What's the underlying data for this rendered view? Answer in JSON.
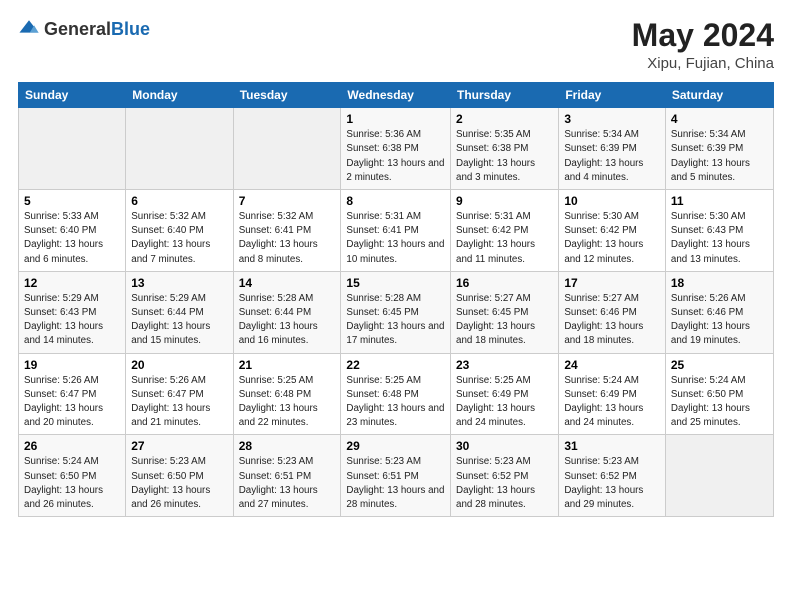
{
  "header": {
    "logo_general": "General",
    "logo_blue": "Blue",
    "title": "May 2024",
    "subtitle": "Xipu, Fujian, China"
  },
  "weekdays": [
    "Sunday",
    "Monday",
    "Tuesday",
    "Wednesday",
    "Thursday",
    "Friday",
    "Saturday"
  ],
  "weeks": [
    [
      {
        "day": "",
        "sunrise": "",
        "sunset": "",
        "daylight": "",
        "empty": true
      },
      {
        "day": "",
        "sunrise": "",
        "sunset": "",
        "daylight": "",
        "empty": true
      },
      {
        "day": "",
        "sunrise": "",
        "sunset": "",
        "daylight": "",
        "empty": true
      },
      {
        "day": "1",
        "sunrise": "Sunrise: 5:36 AM",
        "sunset": "Sunset: 6:38 PM",
        "daylight": "Daylight: 13 hours and 2 minutes.",
        "empty": false
      },
      {
        "day": "2",
        "sunrise": "Sunrise: 5:35 AM",
        "sunset": "Sunset: 6:38 PM",
        "daylight": "Daylight: 13 hours and 3 minutes.",
        "empty": false
      },
      {
        "day": "3",
        "sunrise": "Sunrise: 5:34 AM",
        "sunset": "Sunset: 6:39 PM",
        "daylight": "Daylight: 13 hours and 4 minutes.",
        "empty": false
      },
      {
        "day": "4",
        "sunrise": "Sunrise: 5:34 AM",
        "sunset": "Sunset: 6:39 PM",
        "daylight": "Daylight: 13 hours and 5 minutes.",
        "empty": false
      }
    ],
    [
      {
        "day": "5",
        "sunrise": "Sunrise: 5:33 AM",
        "sunset": "Sunset: 6:40 PM",
        "daylight": "Daylight: 13 hours and 6 minutes.",
        "empty": false
      },
      {
        "day": "6",
        "sunrise": "Sunrise: 5:32 AM",
        "sunset": "Sunset: 6:40 PM",
        "daylight": "Daylight: 13 hours and 7 minutes.",
        "empty": false
      },
      {
        "day": "7",
        "sunrise": "Sunrise: 5:32 AM",
        "sunset": "Sunset: 6:41 PM",
        "daylight": "Daylight: 13 hours and 8 minutes.",
        "empty": false
      },
      {
        "day": "8",
        "sunrise": "Sunrise: 5:31 AM",
        "sunset": "Sunset: 6:41 PM",
        "daylight": "Daylight: 13 hours and 10 minutes.",
        "empty": false
      },
      {
        "day": "9",
        "sunrise": "Sunrise: 5:31 AM",
        "sunset": "Sunset: 6:42 PM",
        "daylight": "Daylight: 13 hours and 11 minutes.",
        "empty": false
      },
      {
        "day": "10",
        "sunrise": "Sunrise: 5:30 AM",
        "sunset": "Sunset: 6:42 PM",
        "daylight": "Daylight: 13 hours and 12 minutes.",
        "empty": false
      },
      {
        "day": "11",
        "sunrise": "Sunrise: 5:30 AM",
        "sunset": "Sunset: 6:43 PM",
        "daylight": "Daylight: 13 hours and 13 minutes.",
        "empty": false
      }
    ],
    [
      {
        "day": "12",
        "sunrise": "Sunrise: 5:29 AM",
        "sunset": "Sunset: 6:43 PM",
        "daylight": "Daylight: 13 hours and 14 minutes.",
        "empty": false
      },
      {
        "day": "13",
        "sunrise": "Sunrise: 5:29 AM",
        "sunset": "Sunset: 6:44 PM",
        "daylight": "Daylight: 13 hours and 15 minutes.",
        "empty": false
      },
      {
        "day": "14",
        "sunrise": "Sunrise: 5:28 AM",
        "sunset": "Sunset: 6:44 PM",
        "daylight": "Daylight: 13 hours and 16 minutes.",
        "empty": false
      },
      {
        "day": "15",
        "sunrise": "Sunrise: 5:28 AM",
        "sunset": "Sunset: 6:45 PM",
        "daylight": "Daylight: 13 hours and 17 minutes.",
        "empty": false
      },
      {
        "day": "16",
        "sunrise": "Sunrise: 5:27 AM",
        "sunset": "Sunset: 6:45 PM",
        "daylight": "Daylight: 13 hours and 18 minutes.",
        "empty": false
      },
      {
        "day": "17",
        "sunrise": "Sunrise: 5:27 AM",
        "sunset": "Sunset: 6:46 PM",
        "daylight": "Daylight: 13 hours and 18 minutes.",
        "empty": false
      },
      {
        "day": "18",
        "sunrise": "Sunrise: 5:26 AM",
        "sunset": "Sunset: 6:46 PM",
        "daylight": "Daylight: 13 hours and 19 minutes.",
        "empty": false
      }
    ],
    [
      {
        "day": "19",
        "sunrise": "Sunrise: 5:26 AM",
        "sunset": "Sunset: 6:47 PM",
        "daylight": "Daylight: 13 hours and 20 minutes.",
        "empty": false
      },
      {
        "day": "20",
        "sunrise": "Sunrise: 5:26 AM",
        "sunset": "Sunset: 6:47 PM",
        "daylight": "Daylight: 13 hours and 21 minutes.",
        "empty": false
      },
      {
        "day": "21",
        "sunrise": "Sunrise: 5:25 AM",
        "sunset": "Sunset: 6:48 PM",
        "daylight": "Daylight: 13 hours and 22 minutes.",
        "empty": false
      },
      {
        "day": "22",
        "sunrise": "Sunrise: 5:25 AM",
        "sunset": "Sunset: 6:48 PM",
        "daylight": "Daylight: 13 hours and 23 minutes.",
        "empty": false
      },
      {
        "day": "23",
        "sunrise": "Sunrise: 5:25 AM",
        "sunset": "Sunset: 6:49 PM",
        "daylight": "Daylight: 13 hours and 24 minutes.",
        "empty": false
      },
      {
        "day": "24",
        "sunrise": "Sunrise: 5:24 AM",
        "sunset": "Sunset: 6:49 PM",
        "daylight": "Daylight: 13 hours and 24 minutes.",
        "empty": false
      },
      {
        "day": "25",
        "sunrise": "Sunrise: 5:24 AM",
        "sunset": "Sunset: 6:50 PM",
        "daylight": "Daylight: 13 hours and 25 minutes.",
        "empty": false
      }
    ],
    [
      {
        "day": "26",
        "sunrise": "Sunrise: 5:24 AM",
        "sunset": "Sunset: 6:50 PM",
        "daylight": "Daylight: 13 hours and 26 minutes.",
        "empty": false
      },
      {
        "day": "27",
        "sunrise": "Sunrise: 5:23 AM",
        "sunset": "Sunset: 6:50 PM",
        "daylight": "Daylight: 13 hours and 26 minutes.",
        "empty": false
      },
      {
        "day": "28",
        "sunrise": "Sunrise: 5:23 AM",
        "sunset": "Sunset: 6:51 PM",
        "daylight": "Daylight: 13 hours and 27 minutes.",
        "empty": false
      },
      {
        "day": "29",
        "sunrise": "Sunrise: 5:23 AM",
        "sunset": "Sunset: 6:51 PM",
        "daylight": "Daylight: 13 hours and 28 minutes.",
        "empty": false
      },
      {
        "day": "30",
        "sunrise": "Sunrise: 5:23 AM",
        "sunset": "Sunset: 6:52 PM",
        "daylight": "Daylight: 13 hours and 28 minutes.",
        "empty": false
      },
      {
        "day": "31",
        "sunrise": "Sunrise: 5:23 AM",
        "sunset": "Sunset: 6:52 PM",
        "daylight": "Daylight: 13 hours and 29 minutes.",
        "empty": false
      },
      {
        "day": "",
        "sunrise": "",
        "sunset": "",
        "daylight": "",
        "empty": true
      }
    ]
  ]
}
